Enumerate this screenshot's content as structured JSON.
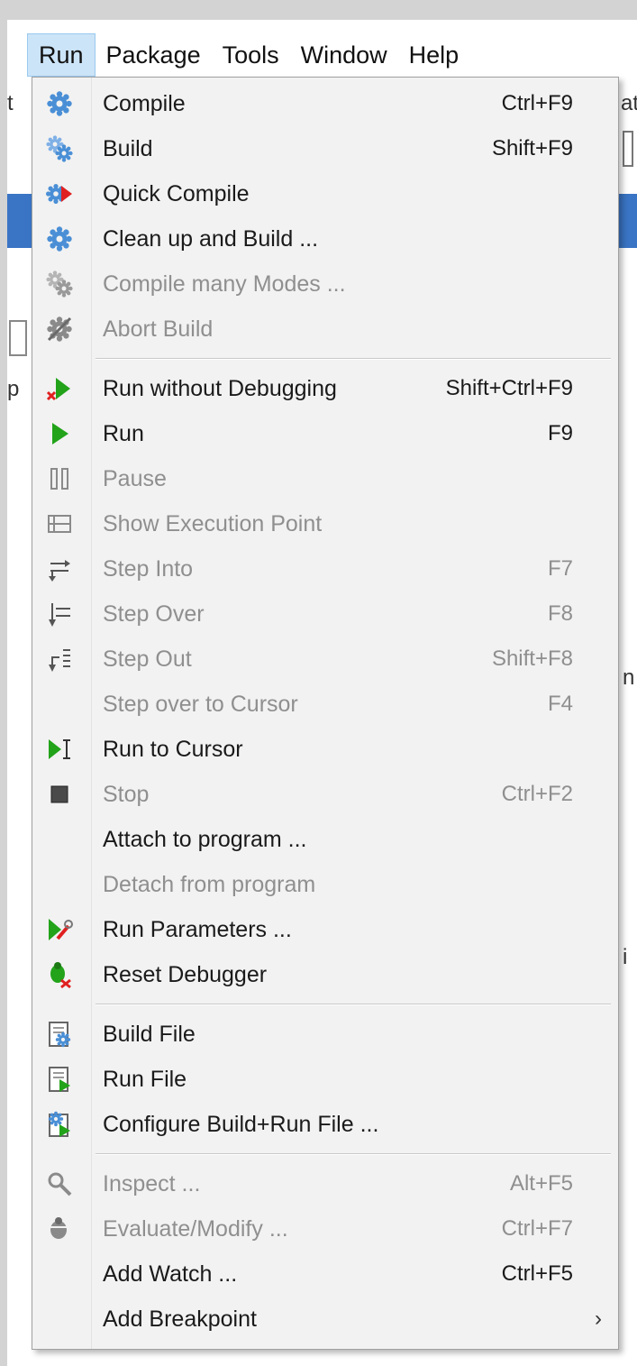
{
  "menubar": {
    "items": [
      {
        "label": "Run",
        "active": true
      },
      {
        "label": "Package",
        "active": false
      },
      {
        "label": "Tools",
        "active": false
      },
      {
        "label": "Window",
        "active": false
      },
      {
        "label": "Help",
        "active": false
      }
    ]
  },
  "background_fragments": {
    "left_t": "t",
    "left_p": "p",
    "right_a": "at",
    "right_n": "n",
    "right_i": "i"
  },
  "colors": {
    "menu_bg": "#f2f2f2",
    "menubar_active": "#cce4f7",
    "disabled_text": "#8f8f8f",
    "run_green": "#22a31a",
    "gear_blue": "#4a8fd6",
    "stop_red": "#e02020"
  },
  "menu": {
    "items": [
      {
        "label": "Compile",
        "shortcut": "Ctrl+F9",
        "icon": "gear-icon",
        "enabled": true
      },
      {
        "label": "Build",
        "shortcut": "Shift+F9",
        "icon": "double-gear-icon",
        "enabled": true
      },
      {
        "label": "Quick Compile",
        "shortcut": "",
        "icon": "quick-compile-icon",
        "enabled": true
      },
      {
        "label": "Clean up and Build ...",
        "shortcut": "",
        "icon": "gear-icon",
        "enabled": true
      },
      {
        "label": "Compile many Modes ...",
        "shortcut": "",
        "icon": "double-gear-gray-icon",
        "enabled": false
      },
      {
        "label": "Abort Build",
        "shortcut": "",
        "icon": "abort-build-icon",
        "enabled": false
      },
      {
        "separator": true
      },
      {
        "label": "Run without Debugging",
        "shortcut": "Shift+Ctrl+F9",
        "icon": "run-no-debug-icon",
        "enabled": true
      },
      {
        "label": "Run",
        "shortcut": "F9",
        "icon": "play-icon",
        "enabled": true
      },
      {
        "label": "Pause",
        "shortcut": "",
        "icon": "pause-icon",
        "enabled": false
      },
      {
        "label": "Show Execution Point",
        "shortcut": "",
        "icon": "execution-point-icon",
        "enabled": false
      },
      {
        "label": "Step Into",
        "shortcut": "F7",
        "icon": "step-into-icon",
        "enabled": false
      },
      {
        "label": "Step Over",
        "shortcut": "F8",
        "icon": "step-over-icon",
        "enabled": false
      },
      {
        "label": "Step Out",
        "shortcut": "Shift+F8",
        "icon": "step-out-icon",
        "enabled": false
      },
      {
        "label": "Step over to Cursor",
        "shortcut": "F4",
        "icon": "",
        "enabled": false
      },
      {
        "label": "Run to Cursor",
        "shortcut": "",
        "icon": "run-to-cursor-icon",
        "enabled": true
      },
      {
        "label": "Stop",
        "shortcut": "Ctrl+F2",
        "icon": "stop-icon",
        "enabled": false
      },
      {
        "label": "Attach to program ...",
        "shortcut": "",
        "icon": "",
        "enabled": true
      },
      {
        "label": "Detach from program",
        "shortcut": "",
        "icon": "",
        "enabled": false
      },
      {
        "label": "Run Parameters ...",
        "shortcut": "",
        "icon": "run-parameters-icon",
        "enabled": true
      },
      {
        "label": "Reset Debugger",
        "shortcut": "",
        "icon": "reset-debugger-icon",
        "enabled": true
      },
      {
        "separator": true
      },
      {
        "label": "Build File",
        "shortcut": "",
        "icon": "build-file-icon",
        "enabled": true
      },
      {
        "label": "Run File",
        "shortcut": "",
        "icon": "run-file-icon",
        "enabled": true
      },
      {
        "label": "Configure Build+Run File ...",
        "shortcut": "",
        "icon": "configure-build-run-icon",
        "enabled": true
      },
      {
        "separator": true
      },
      {
        "label": "Inspect ...",
        "shortcut": "Alt+F5",
        "icon": "inspect-icon",
        "enabled": false
      },
      {
        "label": "Evaluate/Modify ...",
        "shortcut": "Ctrl+F7",
        "icon": "evaluate-icon",
        "enabled": false
      },
      {
        "label": "Add Watch ...",
        "shortcut": "Ctrl+F5",
        "icon": "",
        "enabled": true
      },
      {
        "label": "Add Breakpoint",
        "shortcut": "",
        "icon": "",
        "enabled": true,
        "submenu": true
      }
    ]
  },
  "submenu_arrow_glyph": "›"
}
